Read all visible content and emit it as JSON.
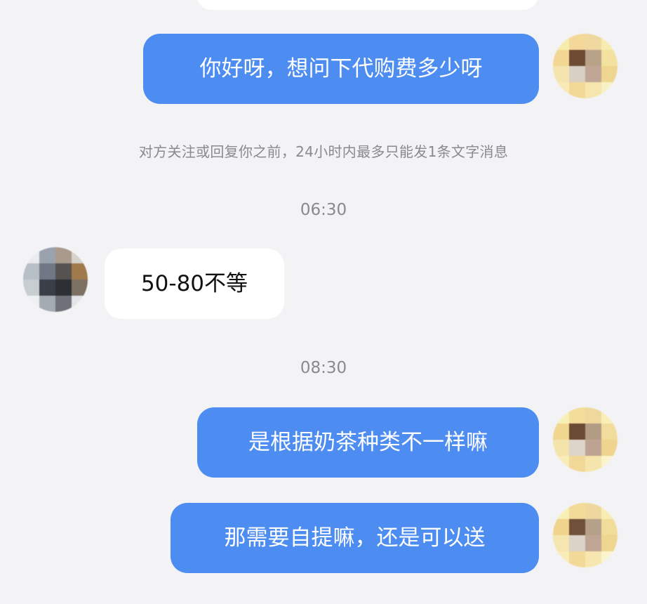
{
  "messages": [
    {
      "id": "m1",
      "direction": "outgoing",
      "text": "你好呀，想问下代购费多少呀"
    },
    {
      "id": "m2",
      "direction": "incoming",
      "text": "50-80不等"
    },
    {
      "id": "m3",
      "direction": "outgoing",
      "text": "是根据奶茶种类不一样嘛"
    },
    {
      "id": "m4",
      "direction": "outgoing",
      "text": "那需要自提嘛，还是可以送"
    }
  ],
  "system_notice": "对方关注或回复你之前，24小时内最多只能发1条文字消息",
  "timestamps": [
    "06:30",
    "08:30"
  ],
  "colors": {
    "background": "#f3f3f5",
    "outgoing_bubble": "#4d8cf0",
    "incoming_bubble": "#ffffff",
    "outgoing_text": "#ffffff",
    "incoming_text": "#111111",
    "meta_text": "#8a8a8e"
  },
  "avatars": {
    "self": "pixelated-avatar",
    "contact": "pixelated-avatar"
  }
}
